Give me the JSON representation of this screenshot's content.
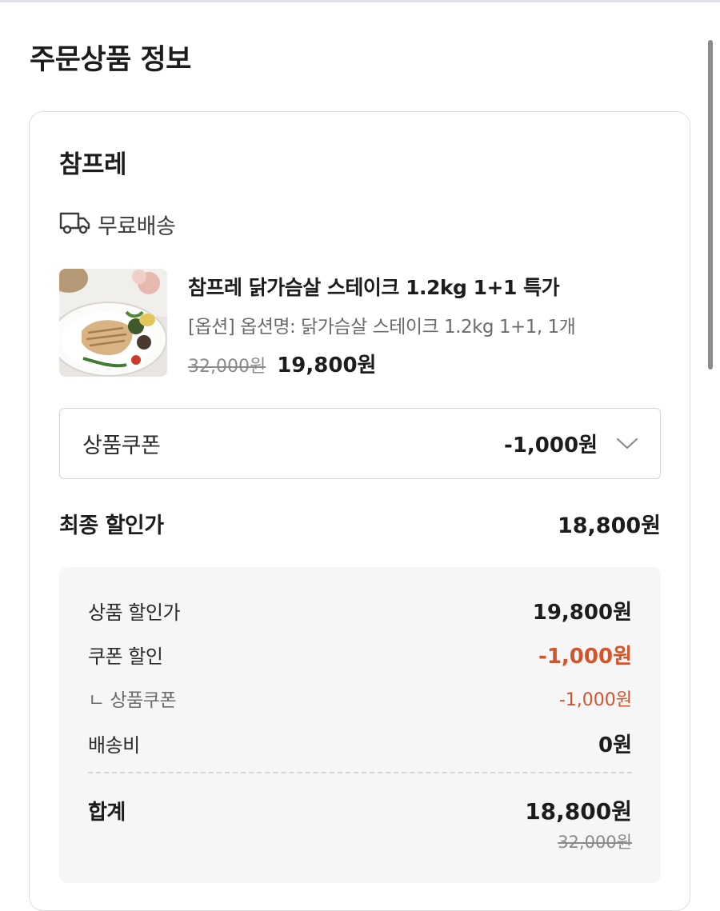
{
  "page": {
    "title": "주문상품 정보"
  },
  "seller": {
    "name": "참프레"
  },
  "shipping": {
    "icon": "truck-icon",
    "label": "무료배송"
  },
  "product": {
    "image_alt": "grilled-chicken-steak-thumbnail",
    "name": "참프레 닭가슴살 스테이크 1.2kg 1+1 특가",
    "option": "[옵션] 옵션명: 닭가슴살 스테이크 1.2kg 1+1, 1개",
    "original_price": "32,000원",
    "sale_price": "19,800원"
  },
  "coupon": {
    "label": "상품쿠폰",
    "value": "-1,000원",
    "icon": "chevron-down-icon"
  },
  "final": {
    "label": "최종 할인가",
    "value": "18,800원"
  },
  "summary": {
    "product_discount_label": "상품 할인가",
    "product_discount_value": "19,800원",
    "coupon_discount_label": "쿠폰 할인",
    "coupon_discount_value": "-1,000원",
    "coupon_sub_label": "ㄴ 상품쿠폰",
    "coupon_sub_value": "-1,000원",
    "shipping_label": "배송비",
    "shipping_value": "0원",
    "total_label": "합계",
    "total_value": "18,800원",
    "total_original": "32,000원"
  },
  "colors": {
    "accent_discount": "#d2542a",
    "border": "#dedede",
    "summary_bg": "#f6f6f6"
  }
}
